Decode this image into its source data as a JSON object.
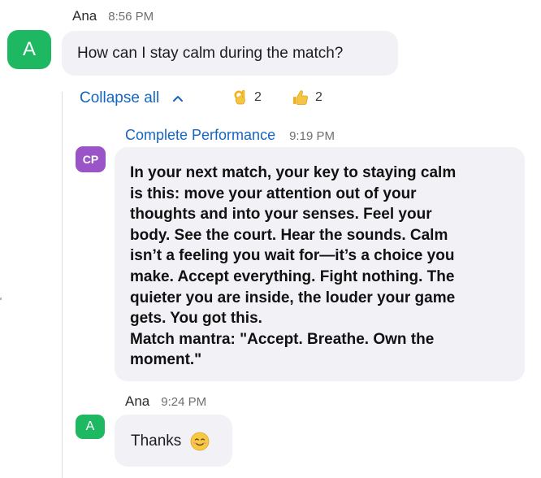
{
  "messages": {
    "first": {
      "sender": "Ana",
      "time": "8:56 PM",
      "avatar_initial": "A",
      "text": "How can I stay calm during the match?"
    },
    "reply": {
      "sender": "Complete Performance",
      "time": "9:19 PM",
      "avatar_initials": "CP",
      "text": "In your next match, your key to staying calm\nis this: move your attention out of your\nthoughts and into your senses. Feel your\nbody. See the court. Hear the sounds. Calm\nisn’t a feeling you wait for—it’s a choice you\nmake. Accept everything. Fight nothing. The\nquieter you are inside, the louder your game\ngets. You got this.\nMatch mantra: \"Accept. Breathe. Own the\nmoment.\""
    },
    "last": {
      "sender": "Ana",
      "time": "9:24 PM",
      "avatar_initial": "A",
      "text": "Thanks"
    }
  },
  "thread": {
    "collapse_label": "Collapse all",
    "reactions": [
      {
        "emoji": "ok-hand-icon",
        "count": "2"
      },
      {
        "emoji": "thumbs-up-icon",
        "count": "2"
      }
    ]
  },
  "colors": {
    "ana_avatar": "#1fb862",
    "cp_avatar": "#9b54c7",
    "link": "#1665c0",
    "bubble": "#f1f1f6"
  }
}
